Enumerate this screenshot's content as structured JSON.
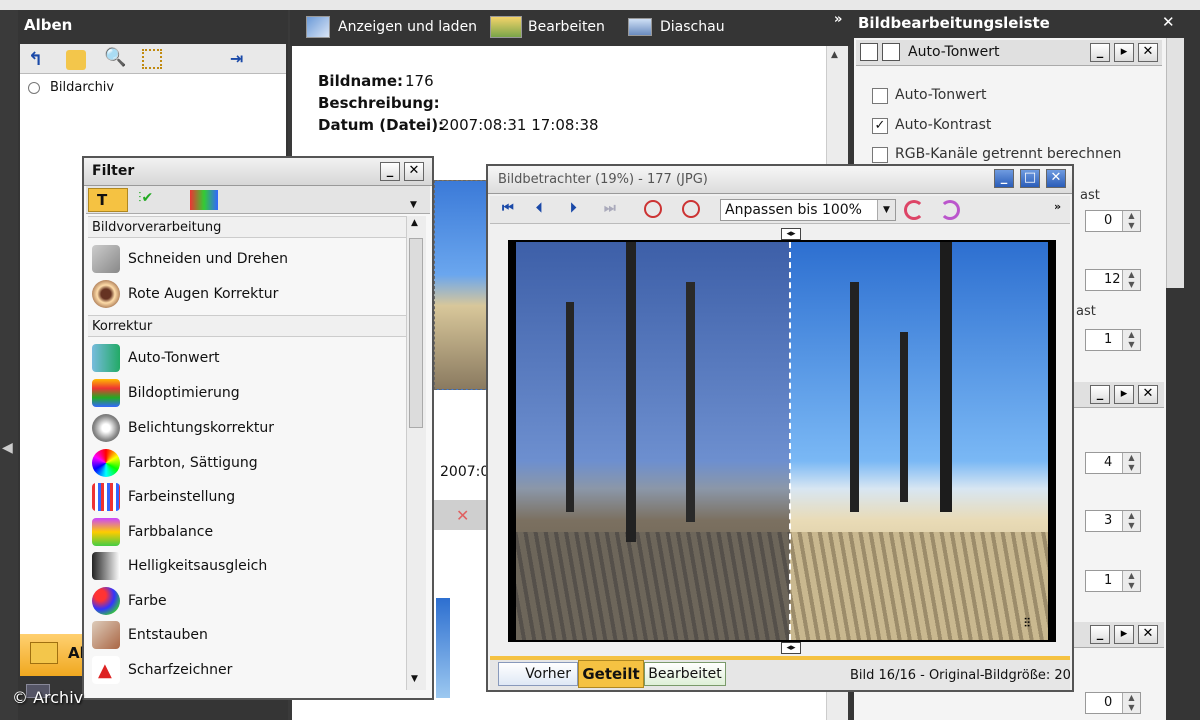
{
  "albums": {
    "title": "Alben",
    "tree_item": "Bildarchiv",
    "bottom_label": "Al"
  },
  "toolbar": {
    "view_label": "Anzeigen und laden",
    "edit_label": "Bearbeiten",
    "slideshow_label": "Diaschau",
    "overflow": "»"
  },
  "info": {
    "name_label": "Bildname:",
    "name_value": "176",
    "desc_label": "Beschreibung:",
    "date_label": "Datum (Datei):",
    "date_value": "2007:08:31 17:08:38",
    "date_partial": "2007:0"
  },
  "filter": {
    "title": "Filter",
    "section_pre": "Bildvorverarbeitung",
    "section_corr": "Korrektur",
    "items_pre": [
      "Schneiden und Drehen",
      "Rote Augen Korrektur"
    ],
    "items_corr": [
      "Auto-Tonwert",
      "Bildoptimierung",
      "Belichtungskorrektur",
      "Farbton, Sättigung",
      "Farbeinstellung",
      "Farbbalance",
      "Helligkeitsausgleich",
      "Farbe",
      "Entstauben",
      "Scharfzeichner"
    ]
  },
  "viewer": {
    "title": "Bildbetrachter (19%) - 177 (JPG)",
    "zoom_select": "Anpassen bis 100%",
    "tabs": [
      "Vorher",
      "Geteilt",
      "Bearbeitet"
    ],
    "status": "Bild 16/16 - Original-Bildgröße: 20"
  },
  "edit_bar": {
    "title": "Bildbearbeitungsleiste",
    "sub_title": "Auto-Tonwert",
    "checkbox_1": "Auto-Tonwert",
    "checkbox_2": "Auto-Kontrast",
    "checkbox_3": "RGB-Kanäle getrennt berechnen",
    "label_ast_1": "ast",
    "label_ast_2": "ast",
    "spins": [
      "0",
      "12",
      "1",
      "4",
      "3",
      "1",
      "0"
    ]
  },
  "watermark": "© Archiv",
  "colors": {
    "accent": "#f5c242",
    "sky": "#2d6fd0",
    "dark": "#353535"
  }
}
